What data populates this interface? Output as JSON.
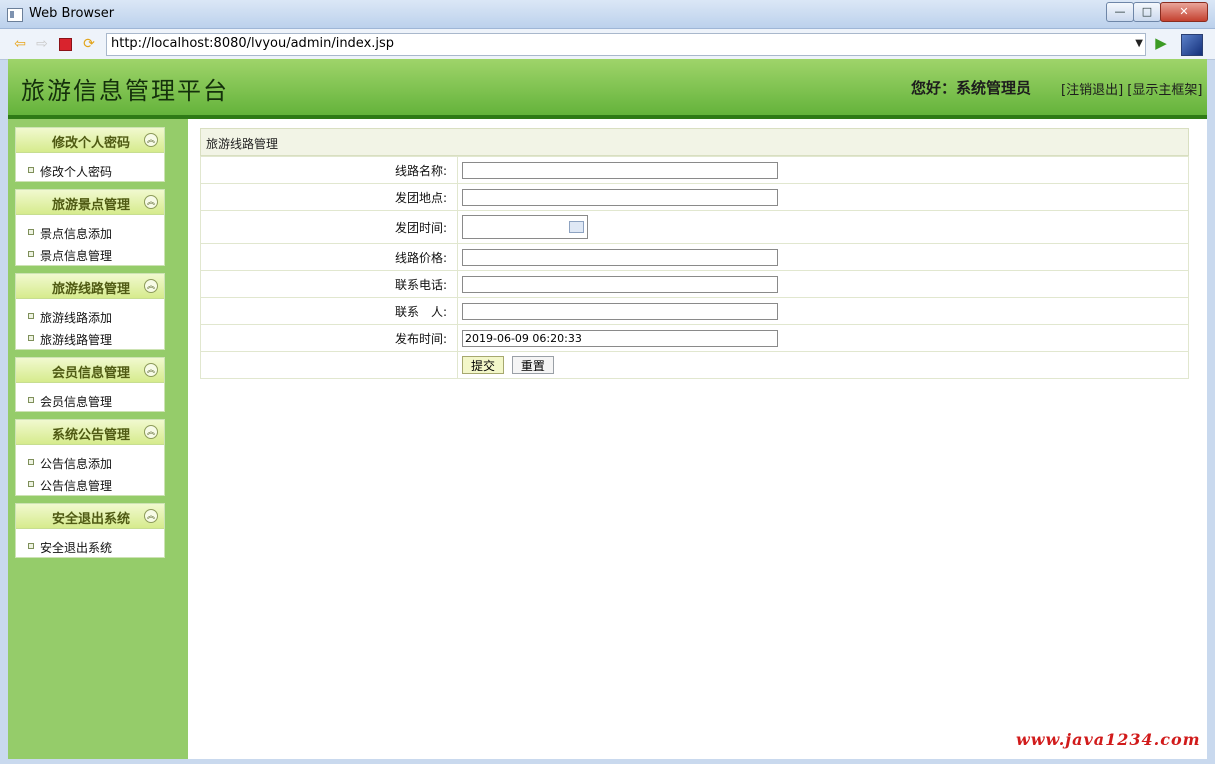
{
  "window": {
    "title": "Web Browser",
    "min": "—",
    "max": "□",
    "close": "✕"
  },
  "browser": {
    "url": "http://localhost:8080/lvyou/admin/index.jsp"
  },
  "header": {
    "title": "旅游信息管理平台",
    "greeting": "您好：系统管理员",
    "logout": "[注销退出]",
    "show_main": "[显示主框架]"
  },
  "sidebar": {
    "groups": [
      {
        "title": "修改个人密码",
        "items": [
          "修改个人密码"
        ]
      },
      {
        "title": "旅游景点管理",
        "items": [
          "景点信息添加",
          "景点信息管理"
        ]
      },
      {
        "title": "旅游线路管理",
        "items": [
          "旅游线路添加",
          "旅游线路管理"
        ]
      },
      {
        "title": "会员信息管理",
        "items": [
          "会员信息管理"
        ]
      },
      {
        "title": "系统公告管理",
        "items": [
          "公告信息添加",
          "公告信息管理"
        ]
      },
      {
        "title": "安全退出系统",
        "items": [
          "安全退出系统"
        ]
      }
    ]
  },
  "form": {
    "heading": "旅游线路管理",
    "labels": {
      "route_name": "线路名称:",
      "departure_place": "发团地点:",
      "departure_time": "发团时间:",
      "route_price": "线路价格:",
      "contact_phone": "联系电话:",
      "contact_person": "联系　人:",
      "publish_time": "发布时间:"
    },
    "values": {
      "route_name": "",
      "departure_place": "",
      "departure_time": "",
      "route_price": "",
      "contact_phone": "",
      "contact_person": "",
      "publish_time": "2019-06-09 06:20:33"
    },
    "buttons": {
      "submit": "提交",
      "reset": "重置"
    }
  },
  "watermark": "www.java1234.com",
  "colors": {
    "header_green": "#64b33b",
    "sidebar_green": "#95cc6a",
    "watermark_red": "#d11b1b"
  }
}
